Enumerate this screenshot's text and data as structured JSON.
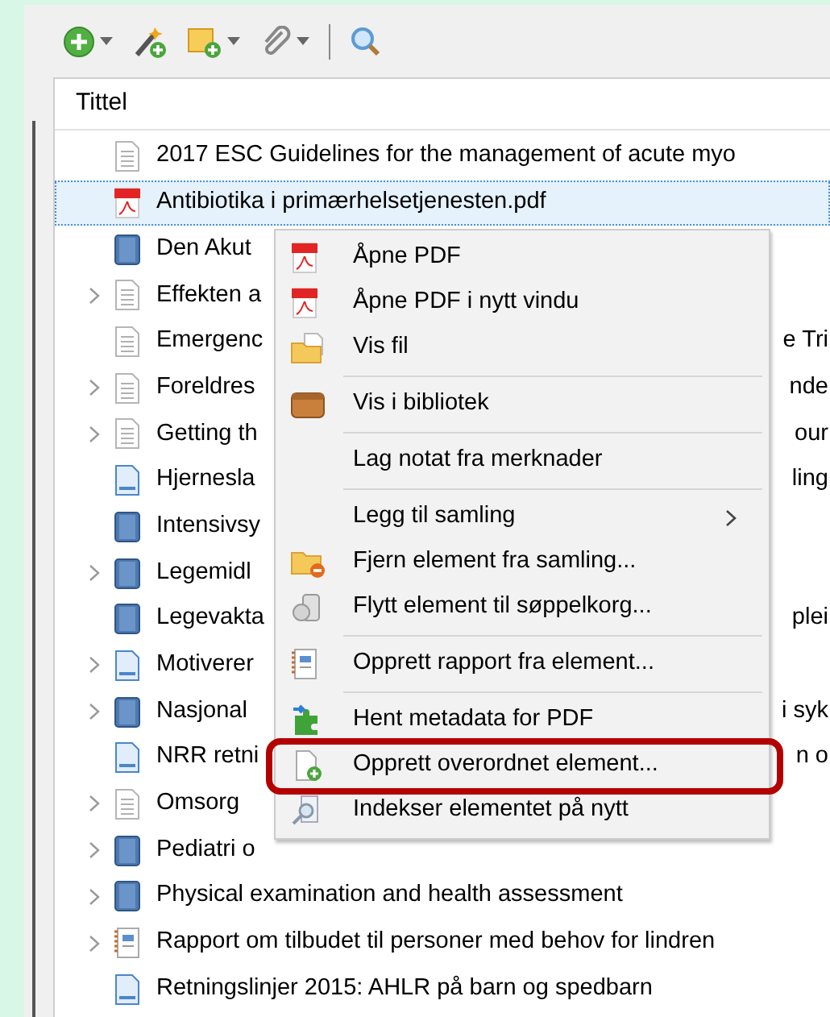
{
  "toolbar": [
    {
      "kind": "button",
      "dropdown": true
    },
    {
      "kind": "button",
      "dropdown": false
    },
    {
      "kind": "button",
      "dropdown": true
    },
    {
      "kind": "button",
      "dropdown": true
    },
    {
      "kind": "separator"
    },
    {
      "kind": "button",
      "dropdown": false
    }
  ],
  "columns": [
    "Tittel"
  ],
  "rows": [
    {
      "kind": "document",
      "expandable": false,
      "selected": false,
      "title": "2017 ESC Guidelines for the management of acute myo"
    },
    {
      "kind": "pdf",
      "expandable": false,
      "selected": true,
      "title": "Antibiotika i primærhelsetjenesten.pdf"
    },
    {
      "kind": "book",
      "expandable": false,
      "selected": false,
      "title": "Den Akut"
    },
    {
      "kind": "document",
      "expandable": true,
      "selected": false,
      "title": "Effekten a"
    },
    {
      "kind": "document",
      "expandable": false,
      "selected": false,
      "title": "Emergenc",
      "title_end": "e Tri"
    },
    {
      "kind": "document",
      "expandable": true,
      "selected": false,
      "title": "Foreldres",
      "title_end": "nde"
    },
    {
      "kind": "document",
      "expandable": true,
      "selected": false,
      "title": "Getting th",
      "title_end": "our"
    },
    {
      "kind": "web_page",
      "expandable": false,
      "selected": false,
      "title": "Hjernesla",
      "title_end": "ling"
    },
    {
      "kind": "book",
      "expandable": false,
      "selected": false,
      "title": "Intensivsy"
    },
    {
      "kind": "book",
      "expandable": true,
      "selected": false,
      "title": "Legemidl"
    },
    {
      "kind": "book",
      "expandable": false,
      "selected": false,
      "title": "Legevakta",
      "title_end": "plei"
    },
    {
      "kind": "web_page",
      "expandable": true,
      "selected": false,
      "title": "Motiverer"
    },
    {
      "kind": "book",
      "expandable": true,
      "selected": false,
      "title": "Nasjonal",
      "title_end": "i syk"
    },
    {
      "kind": "web_page",
      "expandable": false,
      "selected": false,
      "title": "NRR retni",
      "title_end": "n o"
    },
    {
      "kind": "document",
      "expandable": true,
      "selected": false,
      "title": "Omsorg"
    },
    {
      "kind": "book",
      "expandable": true,
      "selected": false,
      "title": "Pediatri o"
    },
    {
      "kind": "book",
      "expandable": true,
      "selected": false,
      "title": "Physical examination and health assessment"
    },
    {
      "kind": "report",
      "expandable": true,
      "selected": false,
      "title": "Rapport om tilbudet til personer med behov for lindren"
    },
    {
      "kind": "web_page",
      "expandable": false,
      "selected": false,
      "title": "Retningslinjer 2015: AHLR på barn og spedbarn"
    }
  ],
  "menu": {
    "items": [
      {
        "kind": "item",
        "label": "Åpne PDF",
        "highlighted": false
      },
      {
        "kind": "item",
        "label": "Åpne PDF i nytt vindu",
        "highlighted": false
      },
      {
        "kind": "item",
        "label": "Vis fil",
        "highlighted": false
      },
      {
        "kind": "separator"
      },
      {
        "kind": "item",
        "label": "Vis i bibliotek",
        "highlighted": false
      },
      {
        "kind": "separator"
      },
      {
        "kind": "item",
        "label": "Lag notat fra merknader",
        "highlighted": false
      },
      {
        "kind": "separator"
      },
      {
        "kind": "submenu",
        "label": "Legg til samling",
        "highlighted": false
      },
      {
        "kind": "item",
        "label": "Fjern element fra samling...",
        "highlighted": false
      },
      {
        "kind": "item",
        "label": "Flytt element til søppelkorg...",
        "highlighted": false
      },
      {
        "kind": "separator"
      },
      {
        "kind": "item",
        "label": "Opprett rapport fra element...",
        "highlighted": false
      },
      {
        "kind": "separator"
      },
      {
        "kind": "item",
        "label": "Hent metadata for PDF",
        "highlighted": false
      },
      {
        "kind": "item",
        "label": "Opprett overordnet element...",
        "highlighted": true
      },
      {
        "kind": "item",
        "label": "Indekser elementet på nytt",
        "highlighted": false
      }
    ]
  }
}
